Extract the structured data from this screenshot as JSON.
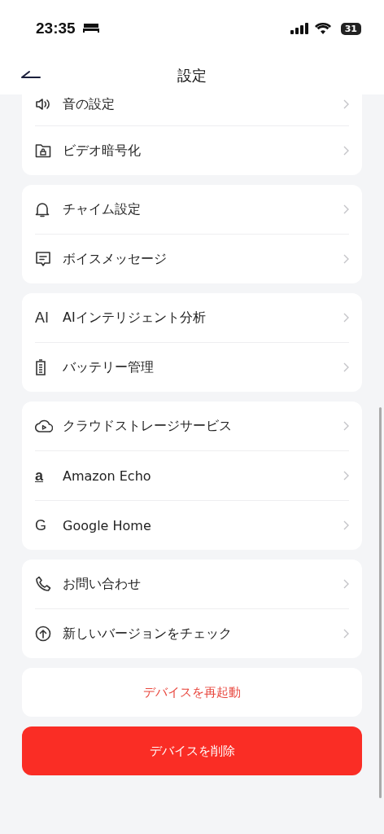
{
  "status_bar": {
    "time": "23:35",
    "battery": "31"
  },
  "header": {
    "title": "設定"
  },
  "groups": [
    {
      "items": [
        {
          "label": "音の設定"
        },
        {
          "label": "ビデオ暗号化"
        }
      ]
    },
    {
      "items": [
        {
          "label": "チャイム設定"
        },
        {
          "label": "ボイスメッセージ"
        }
      ]
    },
    {
      "items": [
        {
          "icon_text": "AI",
          "label": "AIインテリジェント分析"
        },
        {
          "label": "バッテリー管理"
        }
      ]
    },
    {
      "items": [
        {
          "label": "クラウドストレージサービス"
        },
        {
          "icon_text": "a",
          "label": "Amazon Echo"
        },
        {
          "icon_text": "G",
          "label": "Google Home"
        }
      ]
    },
    {
      "items": [
        {
          "label": "お問い合わせ"
        },
        {
          "label": "新しいバージョンをチェック"
        }
      ]
    }
  ],
  "restart_button": "デバイスを再起動",
  "delete_button": "デバイスを削除"
}
